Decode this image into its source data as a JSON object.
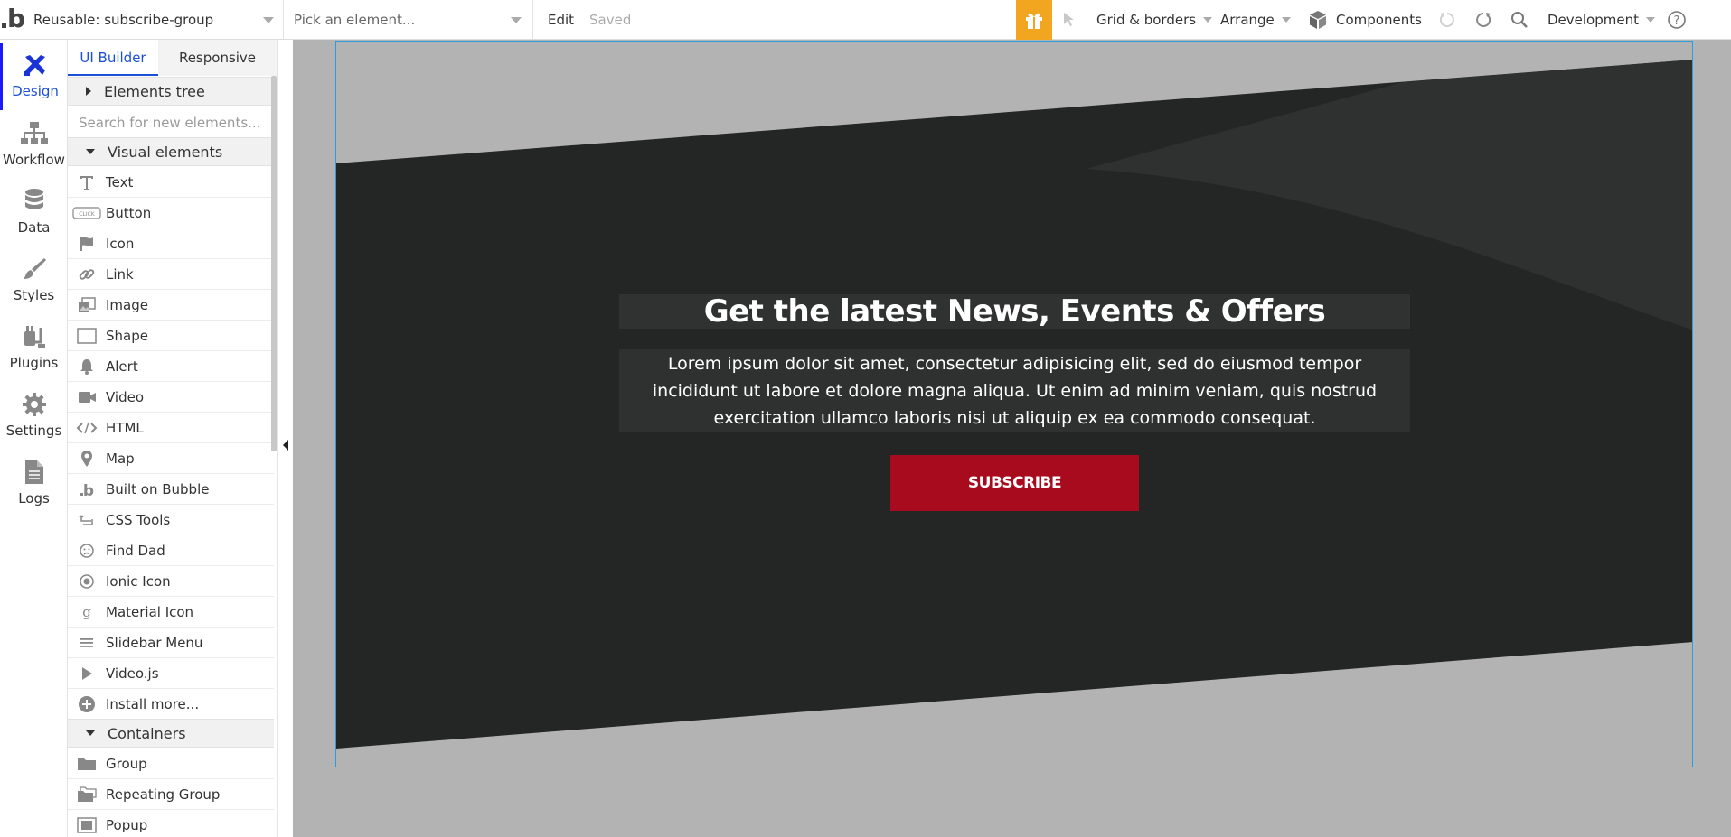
{
  "topbar": {
    "page_select": "Reusable: subscribe-group",
    "element_picker_placeholder": "Pick an element...",
    "edit_label": "Edit",
    "saved_status": "Saved",
    "grid_label": "Grid & borders",
    "arrange_label": "Arrange",
    "components_label": "Components",
    "environment_label": "Development",
    "gift_color": "#f2a620"
  },
  "rail": {
    "items": [
      {
        "label": "Design",
        "icon": "design-icon"
      },
      {
        "label": "Workflow",
        "icon": "workflow-icon"
      },
      {
        "label": "Data",
        "icon": "database-icon"
      },
      {
        "label": "Styles",
        "icon": "brush-icon"
      },
      {
        "label": "Plugins",
        "icon": "plug-icon"
      },
      {
        "label": "Settings",
        "icon": "gear-icon"
      },
      {
        "label": "Logs",
        "icon": "document-icon"
      }
    ]
  },
  "panel": {
    "tab_ui_builder": "UI Builder",
    "tab_responsive": "Responsive",
    "elements_tree": "Elements tree",
    "search_placeholder": "Search for new elements...",
    "visual_elements_header": "Visual elements",
    "visual_elements": [
      {
        "label": "Text",
        "icon": "text-icon"
      },
      {
        "label": "Button",
        "icon": "button-icon"
      },
      {
        "label": "Icon",
        "icon": "flag-icon"
      },
      {
        "label": "Link",
        "icon": "link-icon"
      },
      {
        "label": "Image",
        "icon": "image-icon"
      },
      {
        "label": "Shape",
        "icon": "shape-icon"
      },
      {
        "label": "Alert",
        "icon": "bell-icon"
      },
      {
        "label": "Video",
        "icon": "video-icon"
      },
      {
        "label": "HTML",
        "icon": "code-icon"
      },
      {
        "label": "Map",
        "icon": "map-pin-icon"
      },
      {
        "label": "Built on Bubble",
        "icon": "bubble-logo-icon"
      },
      {
        "label": "CSS Tools",
        "icon": "css-tools-icon"
      },
      {
        "label": "Find Dad",
        "icon": "face-icon"
      },
      {
        "label": "Ionic Icon",
        "icon": "ionic-icon"
      },
      {
        "label": "Material Icon",
        "icon": "material-icon"
      },
      {
        "label": "Slidebar Menu",
        "icon": "menu-icon"
      },
      {
        "label": "Video.js",
        "icon": "play-icon"
      },
      {
        "label": "Install more...",
        "icon": "plus-circle-icon"
      }
    ],
    "containers_header": "Containers",
    "containers": [
      {
        "label": "Group",
        "icon": "folder-icon"
      },
      {
        "label": "Repeating Group",
        "icon": "folders-icon"
      },
      {
        "label": "Popup",
        "icon": "popup-icon"
      }
    ]
  },
  "canvas": {
    "heading": "Get the latest News, Events & Offers",
    "body": "Lorem ipsum dolor sit amet, consectetur adipisicing elit, sed do eiusmod tempor incididunt ut labore et dolore magna aliqua. Ut enim ad minim veniam, quis nostrud exercitation ullamco laboris nisi ut aliquip ex ea commodo consequat.",
    "button_label": "SUBSCRIBE",
    "button_color": "#a80b1d",
    "banner_color": "#242625",
    "canvas_color": "#b3b3b3"
  }
}
